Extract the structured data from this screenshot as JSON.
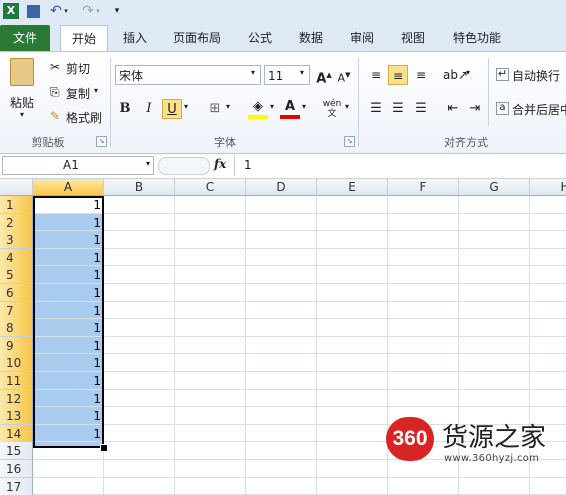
{
  "qat": {
    "undo_icon": "undo-icon",
    "redo_icon": "redo-icon"
  },
  "tabs": [
    "文件",
    "开始",
    "插入",
    "页面布局",
    "公式",
    "数据",
    "审阅",
    "视图",
    "特色功能"
  ],
  "ribbon": {
    "clipboard": {
      "paste": "粘贴",
      "cut": "剪切",
      "copy": "复制",
      "format_painter": "格式刷",
      "group": "剪贴板"
    },
    "font": {
      "name": "宋体",
      "size": "11",
      "bold": "B",
      "italic": "I",
      "underline": "U",
      "group": "字体",
      "grow": "A",
      "shrink": "A",
      "wen": "wén",
      "fontcolor": "A"
    },
    "alignment": {
      "wrap": "自动换行",
      "merge": "合并后居中",
      "group": "对齐方式"
    }
  },
  "formula_bar": {
    "name_box": "A1",
    "fx": "fx",
    "value": "1"
  },
  "columns": [
    "A",
    "B",
    "C",
    "D",
    "E",
    "F",
    "G",
    "H"
  ],
  "rows": [
    "1",
    "2",
    "3",
    "4",
    "5",
    "6",
    "7",
    "8",
    "9",
    "10",
    "11",
    "12",
    "13",
    "14",
    "15",
    "16",
    "17"
  ],
  "column_a_values": [
    "1",
    "1",
    "1",
    "1",
    "1",
    "1",
    "1",
    "1",
    "1",
    "1",
    "1",
    "1",
    "1",
    "1"
  ],
  "watermark": {
    "logo": "360",
    "text": "货源之家",
    "url": "www.360hyzj.com"
  }
}
